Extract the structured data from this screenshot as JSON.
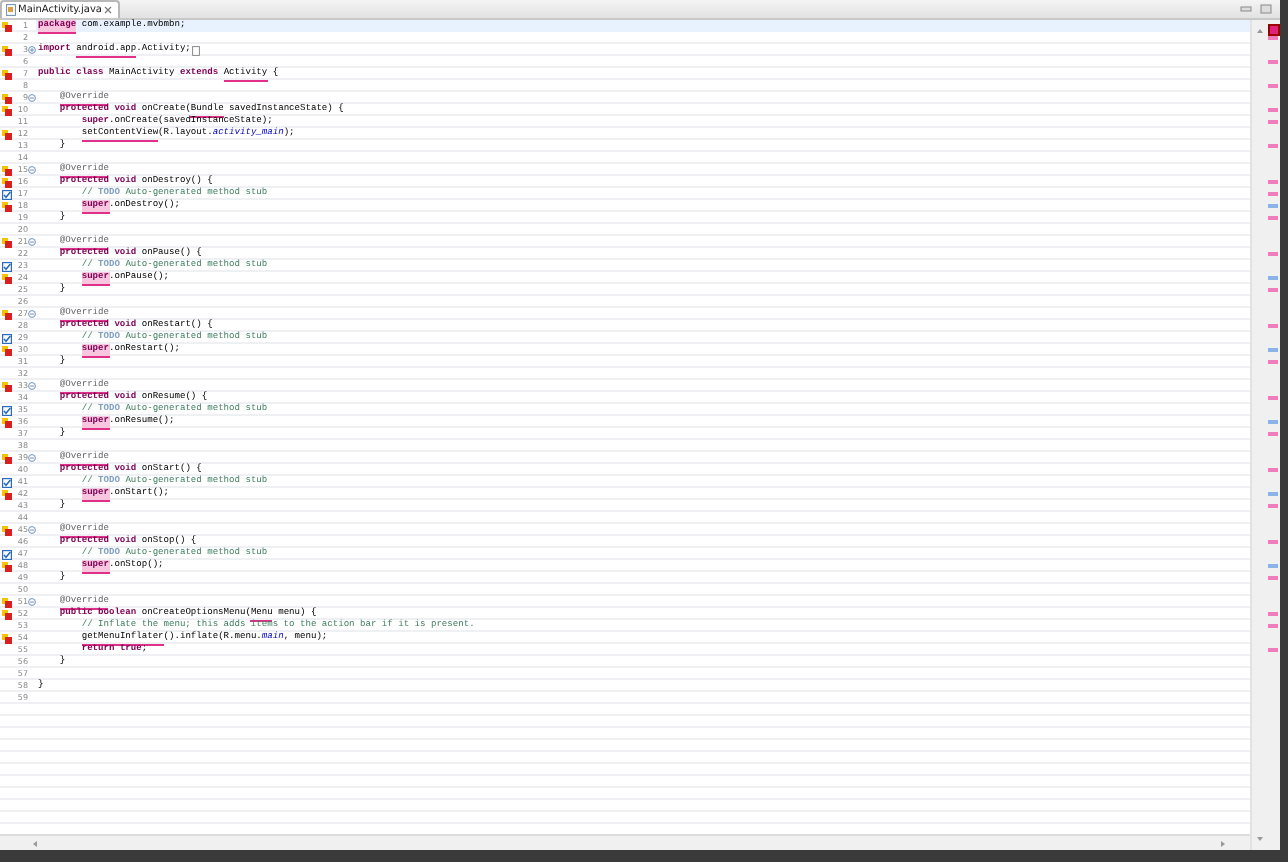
{
  "tab": {
    "title": "MainActivity.java",
    "selected": true
  },
  "lines": [
    {
      "number": "1",
      "current": true,
      "marker": {
        "kind": "error"
      },
      "tokens": [
        {
          "text": "package",
          "kind": "keyword_error"
        },
        {
          "text": " com.example.mvbmbn;",
          "kind": "plain"
        }
      ]
    },
    {
      "number": "2",
      "current": false
    },
    {
      "number": "3",
      "current": false,
      "marker": {
        "kind": "error"
      },
      "fold": {
        "kind": "expand"
      },
      "folded": true,
      "tokens": [
        {
          "text": "import",
          "kind": "keyword"
        },
        {
          "text": " android.app",
          "kind": "error"
        },
        {
          "text": ".Activity;",
          "kind": "plain"
        }
      ]
    },
    {
      "number": "6",
      "current": false
    },
    {
      "number": "7",
      "current": false,
      "marker": {
        "kind": "error"
      },
      "tokens": [
        {
          "text": "public class",
          "kind": "keyword"
        },
        {
          "text": " MainActivity ",
          "kind": "plain"
        },
        {
          "text": "extends",
          "kind": "keyword"
        },
        {
          "text": " Activity",
          "kind": "error"
        },
        {
          "text": " {",
          "kind": "plain"
        }
      ]
    },
    {
      "number": "8",
      "current": false
    },
    {
      "number": "9",
      "current": false,
      "marker": {
        "kind": "error"
      },
      "fold": {
        "kind": "collapse"
      },
      "tokens": [
        {
          "text": "    @Override",
          "kind": "annotation_error"
        }
      ]
    },
    {
      "number": "10",
      "current": false,
      "marker": {
        "kind": "error"
      },
      "tokens": [
        {
          "text": "    protected void",
          "kind": "keyword"
        },
        {
          "text": " onCreate(",
          "kind": "plain"
        },
        {
          "text": "Bundle",
          "kind": "error"
        },
        {
          "text": " savedInstanceState) {",
          "kind": "plain"
        }
      ]
    },
    {
      "number": "11",
      "current": false,
      "tokens": [
        {
          "text": "        super",
          "kind": "keyword"
        },
        {
          "text": ".onCreate(savedInstanceState);",
          "kind": "plain"
        }
      ]
    },
    {
      "number": "12",
      "current": false,
      "marker": {
        "kind": "error"
      },
      "tokens": [
        {
          "text": "        setContentView",
          "kind": "error"
        },
        {
          "text": "(R.layout.",
          "kind": "plain"
        },
        {
          "text": "activity_main",
          "kind": "field"
        },
        {
          "text": ");",
          "kind": "plain"
        }
      ]
    },
    {
      "number": "13",
      "current": false,
      "tokens": [
        {
          "text": "    }",
          "kind": "plain"
        }
      ]
    },
    {
      "number": "14",
      "current": false
    },
    {
      "number": "15",
      "current": false,
      "marker": {
        "kind": "error"
      },
      "fold": {
        "kind": "collapse"
      },
      "tokens": [
        {
          "text": "    @Override",
          "kind": "annotation_error"
        }
      ]
    },
    {
      "number": "16",
      "current": false,
      "marker": {
        "kind": "error"
      },
      "tokens": [
        {
          "text": "    protected void",
          "kind": "keyword"
        },
        {
          "text": " onDestroy() {",
          "kind": "plain"
        }
      ]
    },
    {
      "number": "17",
      "current": false,
      "marker": {
        "kind": "task"
      },
      "tokens": [
        {
          "text": "        // ",
          "kind": "comment"
        },
        {
          "text": "TODO",
          "kind": "task_tag"
        },
        {
          "text": " Auto-generated method stub",
          "kind": "comment"
        }
      ]
    },
    {
      "number": "18",
      "current": false,
      "marker": {
        "kind": "error"
      },
      "tokens": [
        {
          "text": "        super",
          "kind": "keyword_error"
        },
        {
          "text": ".onDestroy();",
          "kind": "plain"
        }
      ]
    },
    {
      "number": "19",
      "current": false,
      "tokens": [
        {
          "text": "    }",
          "kind": "plain"
        }
      ]
    },
    {
      "number": "20",
      "current": false
    },
    {
      "number": "21",
      "current": false,
      "marker": {
        "kind": "error"
      },
      "fold": {
        "kind": "collapse"
      },
      "tokens": [
        {
          "text": "    @Override",
          "kind": "annotation_error"
        }
      ]
    },
    {
      "number": "22",
      "current": false,
      "tokens": [
        {
          "text": "    protected void",
          "kind": "keyword"
        },
        {
          "text": " onPause() {",
          "kind": "plain"
        }
      ]
    },
    {
      "number": "23",
      "current": false,
      "marker": {
        "kind": "task"
      },
      "tokens": [
        {
          "text": "        // ",
          "kind": "comment"
        },
        {
          "text": "TODO",
          "kind": "task_tag"
        },
        {
          "text": " Auto-generated method stub",
          "kind": "comment"
        }
      ]
    },
    {
      "number": "24",
      "current": false,
      "marker": {
        "kind": "error"
      },
      "tokens": [
        {
          "text": "        super",
          "kind": "keyword_error"
        },
        {
          "text": ".onPause();",
          "kind": "plain"
        }
      ]
    },
    {
      "number": "25",
      "current": false,
      "tokens": [
        {
          "text": "    }",
          "kind": "plain"
        }
      ]
    },
    {
      "number": "26",
      "current": false
    },
    {
      "number": "27",
      "current": false,
      "marker": {
        "kind": "error"
      },
      "fold": {
        "kind": "collapse"
      },
      "tokens": [
        {
          "text": "    @Override",
          "kind": "annotation_error"
        }
      ]
    },
    {
      "number": "28",
      "current": false,
      "tokens": [
        {
          "text": "    protected void",
          "kind": "keyword"
        },
        {
          "text": " onRestart() {",
          "kind": "plain"
        }
      ]
    },
    {
      "number": "29",
      "current": false,
      "marker": {
        "kind": "task"
      },
      "tokens": [
        {
          "text": "        // ",
          "kind": "comment"
        },
        {
          "text": "TODO",
          "kind": "task_tag"
        },
        {
          "text": " Auto-generated method stub",
          "kind": "comment"
        }
      ]
    },
    {
      "number": "30",
      "current": false,
      "marker": {
        "kind": "error"
      },
      "tokens": [
        {
          "text": "        super",
          "kind": "keyword_error"
        },
        {
          "text": ".onRestart();",
          "kind": "plain"
        }
      ]
    },
    {
      "number": "31",
      "current": false,
      "tokens": [
        {
          "text": "    }",
          "kind": "plain"
        }
      ]
    },
    {
      "number": "32",
      "current": false
    },
    {
      "number": "33",
      "current": false,
      "marker": {
        "kind": "error"
      },
      "fold": {
        "kind": "collapse"
      },
      "tokens": [
        {
          "text": "    @Override",
          "kind": "annotation_error"
        }
      ]
    },
    {
      "number": "34",
      "current": false,
      "tokens": [
        {
          "text": "    protected void",
          "kind": "keyword"
        },
        {
          "text": " onResume() {",
          "kind": "plain"
        }
      ]
    },
    {
      "number": "35",
      "current": false,
      "marker": {
        "kind": "task"
      },
      "tokens": [
        {
          "text": "        // ",
          "kind": "comment"
        },
        {
          "text": "TODO",
          "kind": "task_tag"
        },
        {
          "text": " Auto-generated method stub",
          "kind": "comment"
        }
      ]
    },
    {
      "number": "36",
      "current": false,
      "marker": {
        "kind": "error"
      },
      "tokens": [
        {
          "text": "        super",
          "kind": "keyword_error"
        },
        {
          "text": ".onResume();",
          "kind": "plain"
        }
      ]
    },
    {
      "number": "37",
      "current": false,
      "tokens": [
        {
          "text": "    }",
          "kind": "plain"
        }
      ]
    },
    {
      "number": "38",
      "current": false
    },
    {
      "number": "39",
      "current": false,
      "marker": {
        "kind": "error"
      },
      "fold": {
        "kind": "collapse"
      },
      "tokens": [
        {
          "text": "    @Override",
          "kind": "annotation_error"
        }
      ]
    },
    {
      "number": "40",
      "current": false,
      "tokens": [
        {
          "text": "    protected void",
          "kind": "keyword"
        },
        {
          "text": " onStart() {",
          "kind": "plain"
        }
      ]
    },
    {
      "number": "41",
      "current": false,
      "marker": {
        "kind": "task"
      },
      "tokens": [
        {
          "text": "        // ",
          "kind": "comment"
        },
        {
          "text": "TODO",
          "kind": "task_tag"
        },
        {
          "text": " Auto-generated method stub",
          "kind": "comment"
        }
      ]
    },
    {
      "number": "42",
      "current": false,
      "marker": {
        "kind": "error"
      },
      "tokens": [
        {
          "text": "        super",
          "kind": "keyword_error"
        },
        {
          "text": ".onStart();",
          "kind": "plain"
        }
      ]
    },
    {
      "number": "43",
      "current": false,
      "tokens": [
        {
          "text": "    }",
          "kind": "plain"
        }
      ]
    },
    {
      "number": "44",
      "current": false
    },
    {
      "number": "45",
      "current": false,
      "marker": {
        "kind": "error"
      },
      "fold": {
        "kind": "collapse"
      },
      "tokens": [
        {
          "text": "    @Override",
          "kind": "annotation_error"
        }
      ]
    },
    {
      "number": "46",
      "current": false,
      "tokens": [
        {
          "text": "    protected void",
          "kind": "keyword"
        },
        {
          "text": " onStop() {",
          "kind": "plain"
        }
      ]
    },
    {
      "number": "47",
      "current": false,
      "marker": {
        "kind": "task"
      },
      "tokens": [
        {
          "text": "        // ",
          "kind": "comment"
        },
        {
          "text": "TODO",
          "kind": "task_tag"
        },
        {
          "text": " Auto-generated method stub",
          "kind": "comment"
        }
      ]
    },
    {
      "number": "48",
      "current": false,
      "marker": {
        "kind": "error"
      },
      "tokens": [
        {
          "text": "        super",
          "kind": "keyword_error"
        },
        {
          "text": ".onStop();",
          "kind": "plain"
        }
      ]
    },
    {
      "number": "49",
      "current": false,
      "tokens": [
        {
          "text": "    }",
          "kind": "plain"
        }
      ]
    },
    {
      "number": "50",
      "current": false
    },
    {
      "number": "51",
      "current": false,
      "marker": {
        "kind": "error"
      },
      "fold": {
        "kind": "collapse"
      },
      "tokens": [
        {
          "text": "    @Override",
          "kind": "annotation_error"
        }
      ]
    },
    {
      "number": "52",
      "current": false,
      "marker": {
        "kind": "error"
      },
      "tokens": [
        {
          "text": "    public boolean",
          "kind": "keyword"
        },
        {
          "text": " onCreateOptionsMenu(",
          "kind": "plain"
        },
        {
          "text": "Menu",
          "kind": "error"
        },
        {
          "text": " menu) {",
          "kind": "plain"
        }
      ]
    },
    {
      "number": "53",
      "current": false,
      "tokens": [
        {
          "text": "        // Inflate the menu; this adds items to the action bar if it is present.",
          "kind": "comment"
        }
      ]
    },
    {
      "number": "54",
      "current": false,
      "marker": {
        "kind": "error"
      },
      "tokens": [
        {
          "text": "        getMenuInflater",
          "kind": "error"
        },
        {
          "text": "().inflate(R.menu.",
          "kind": "plain"
        },
        {
          "text": "main",
          "kind": "field"
        },
        {
          "text": ", menu);",
          "kind": "plain"
        }
      ]
    },
    {
      "number": "55",
      "current": false,
      "tokens": [
        {
          "text": "        return true",
          "kind": "keyword"
        },
        {
          "text": ";",
          "kind": "plain"
        }
      ]
    },
    {
      "number": "56",
      "current": false,
      "tokens": [
        {
          "text": "    }",
          "kind": "plain"
        }
      ]
    },
    {
      "number": "57",
      "current": false
    },
    {
      "number": "58",
      "current": false,
      "tokens": [
        {
          "text": "}",
          "kind": "plain"
        }
      ]
    },
    {
      "number": "59",
      "current": false
    }
  ]
}
